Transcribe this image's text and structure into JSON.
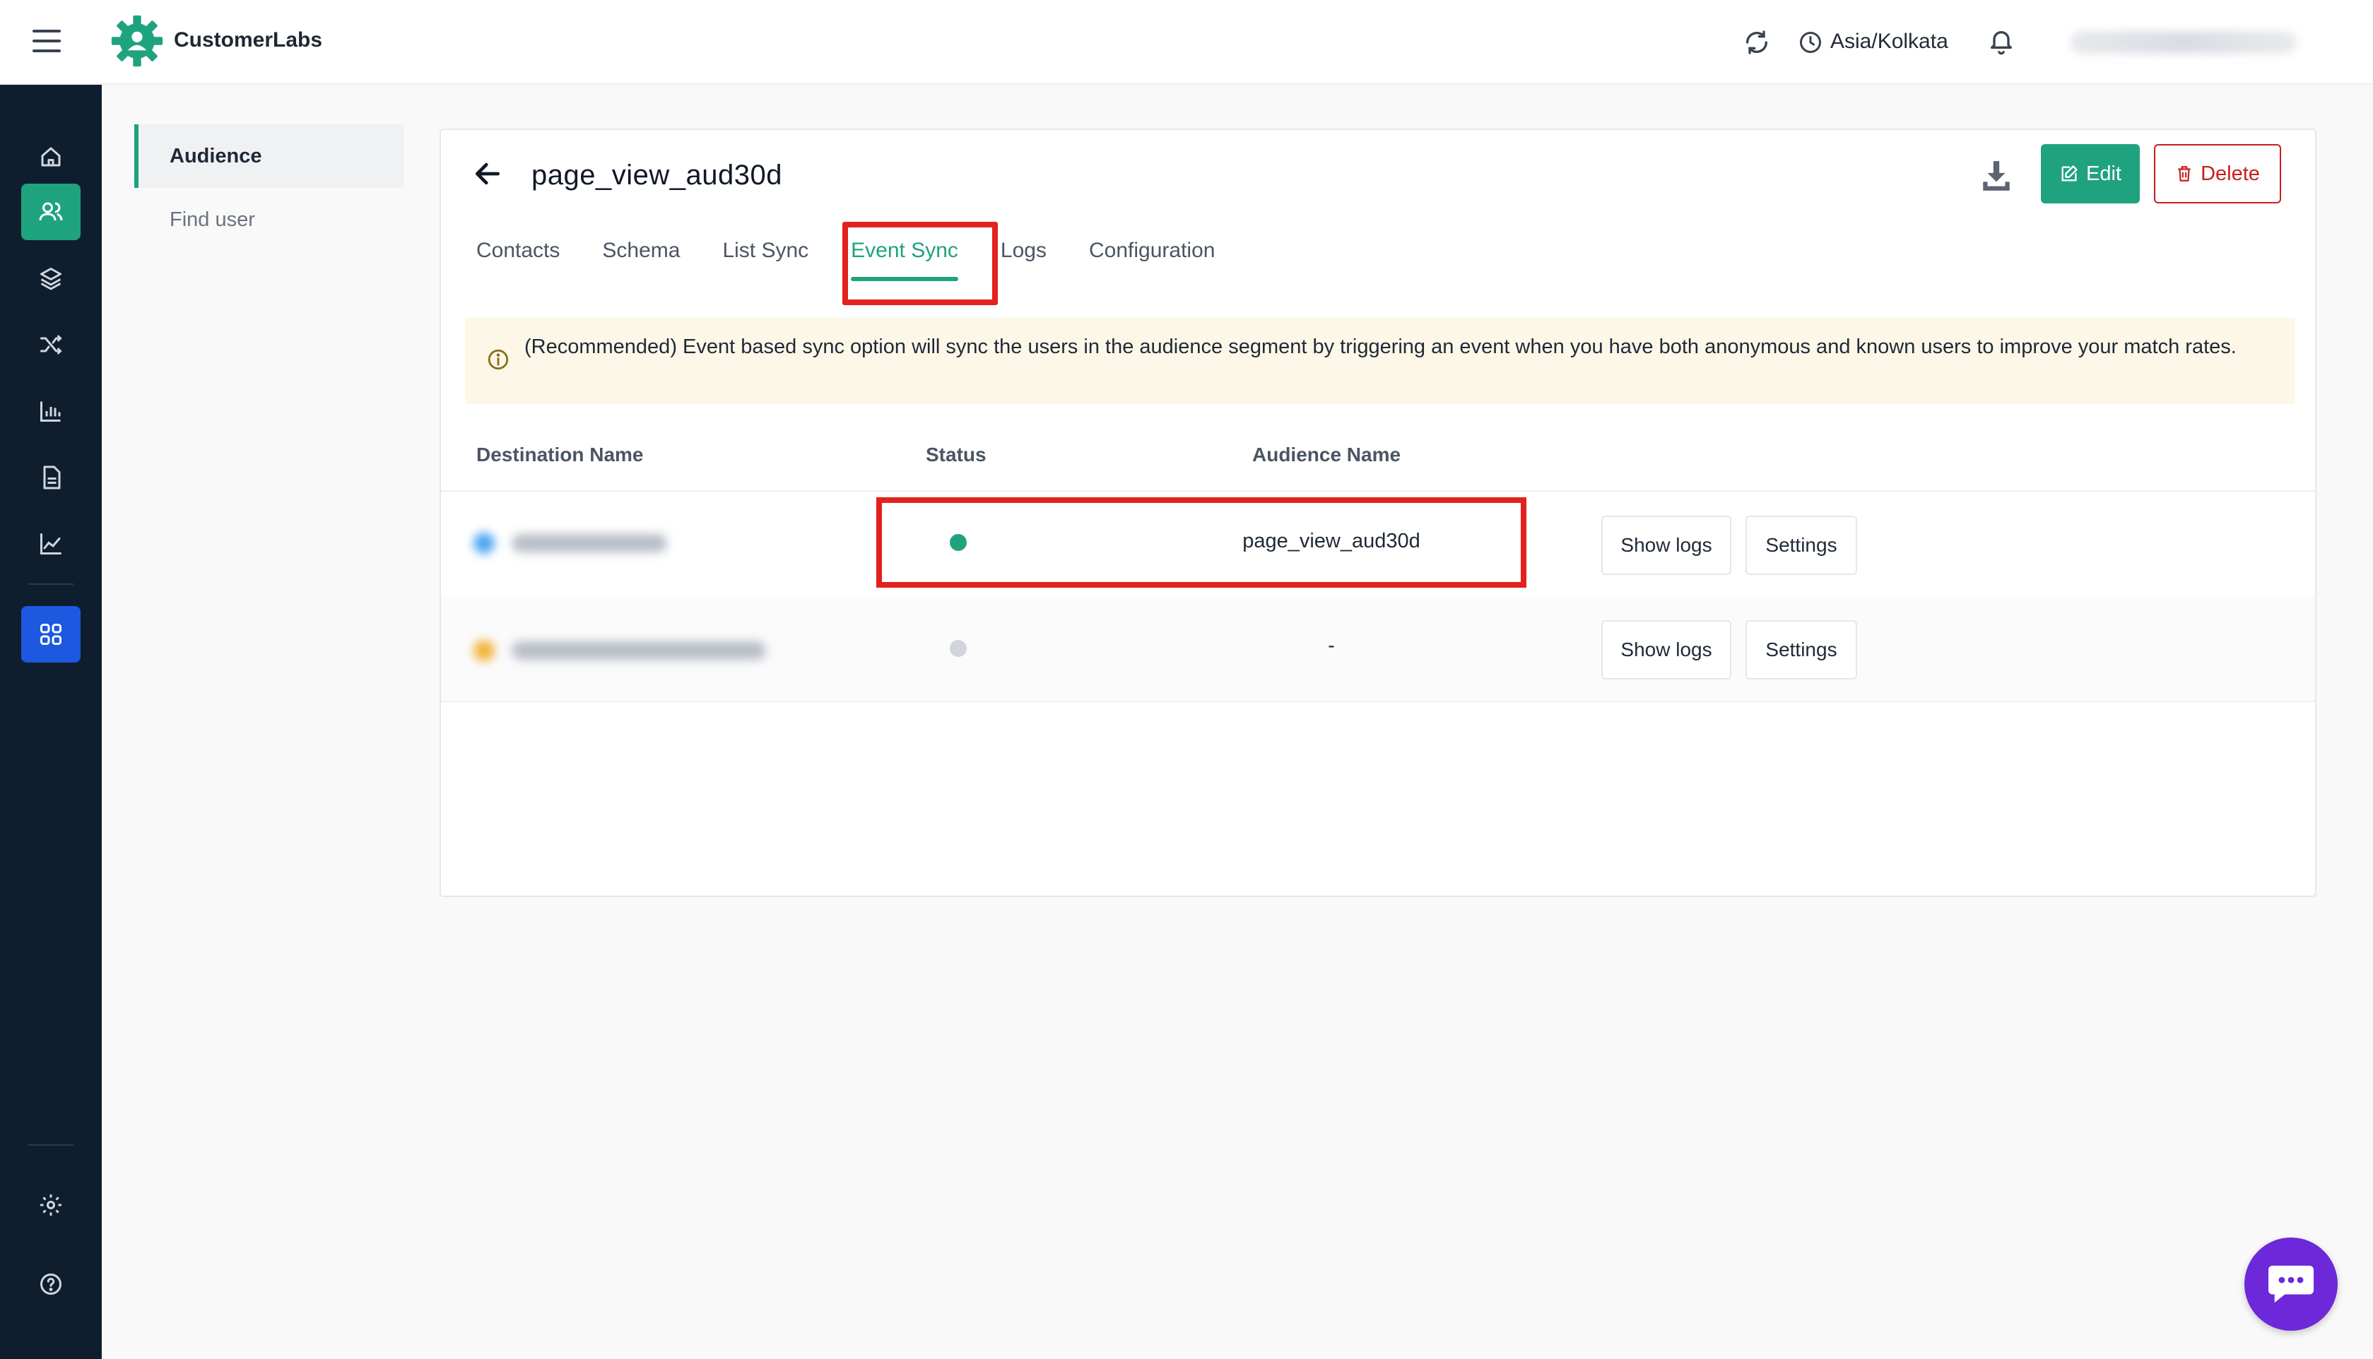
{
  "app": {
    "brand": "CustomerLabs",
    "timezone": "Asia/Kolkata"
  },
  "icons": {
    "menu": "hamburger-icon",
    "logo": "gear-logo-icon",
    "sync": "refresh-icon",
    "timezone": "clock-icon",
    "notifications": "bell-icon",
    "rail": [
      "home-icon",
      "users-icon",
      "layers-icon",
      "shuffle-icon",
      "bar-chart-icon",
      "document-icon",
      "trend-icon",
      "apps-grid-icon",
      "settings-icon",
      "help-icon"
    ],
    "back": "arrow-left-icon",
    "download": "download-icon",
    "edit": "edit-icon",
    "delete": "trash-icon",
    "info": "info-icon",
    "chat": "chat-icon"
  },
  "colors": {
    "accent": "#1fa37f",
    "rail_bg": "#0f1e2e",
    "apps_blue": "#1d58e0",
    "danger": "#c81e1e",
    "highlight": "#e3211d",
    "status_active": "#1fa37f",
    "status_inactive": "#d1d5db",
    "chat": "#6d28d9"
  },
  "subnav": {
    "items": [
      {
        "label": "Audience",
        "active": true
      },
      {
        "label": "Find user",
        "active": false
      }
    ]
  },
  "page": {
    "title": "page_view_aud30d",
    "edit_label": "Edit",
    "delete_label": "Delete"
  },
  "tabs": [
    {
      "label": "Contacts",
      "active": false
    },
    {
      "label": "Schema",
      "active": false
    },
    {
      "label": "List Sync",
      "active": false
    },
    {
      "label": "Event Sync",
      "active": true
    },
    {
      "label": "Logs",
      "active": false
    },
    {
      "label": "Configuration",
      "active": false
    }
  ],
  "info": {
    "text": "(Recommended) Event based sync option will sync the users in the audience segment by triggering an event when you have both anonymous and known users to improve your match rates."
  },
  "table": {
    "columns": [
      "Destination Name",
      "Status",
      "Audience Name"
    ],
    "rows": [
      {
        "status": "active",
        "audience_name": "page_view_aud30d",
        "show_logs": "Show logs",
        "settings": "Settings"
      },
      {
        "status": "inactive",
        "audience_name": "-",
        "show_logs": "Show logs",
        "settings": "Settings"
      }
    ]
  }
}
